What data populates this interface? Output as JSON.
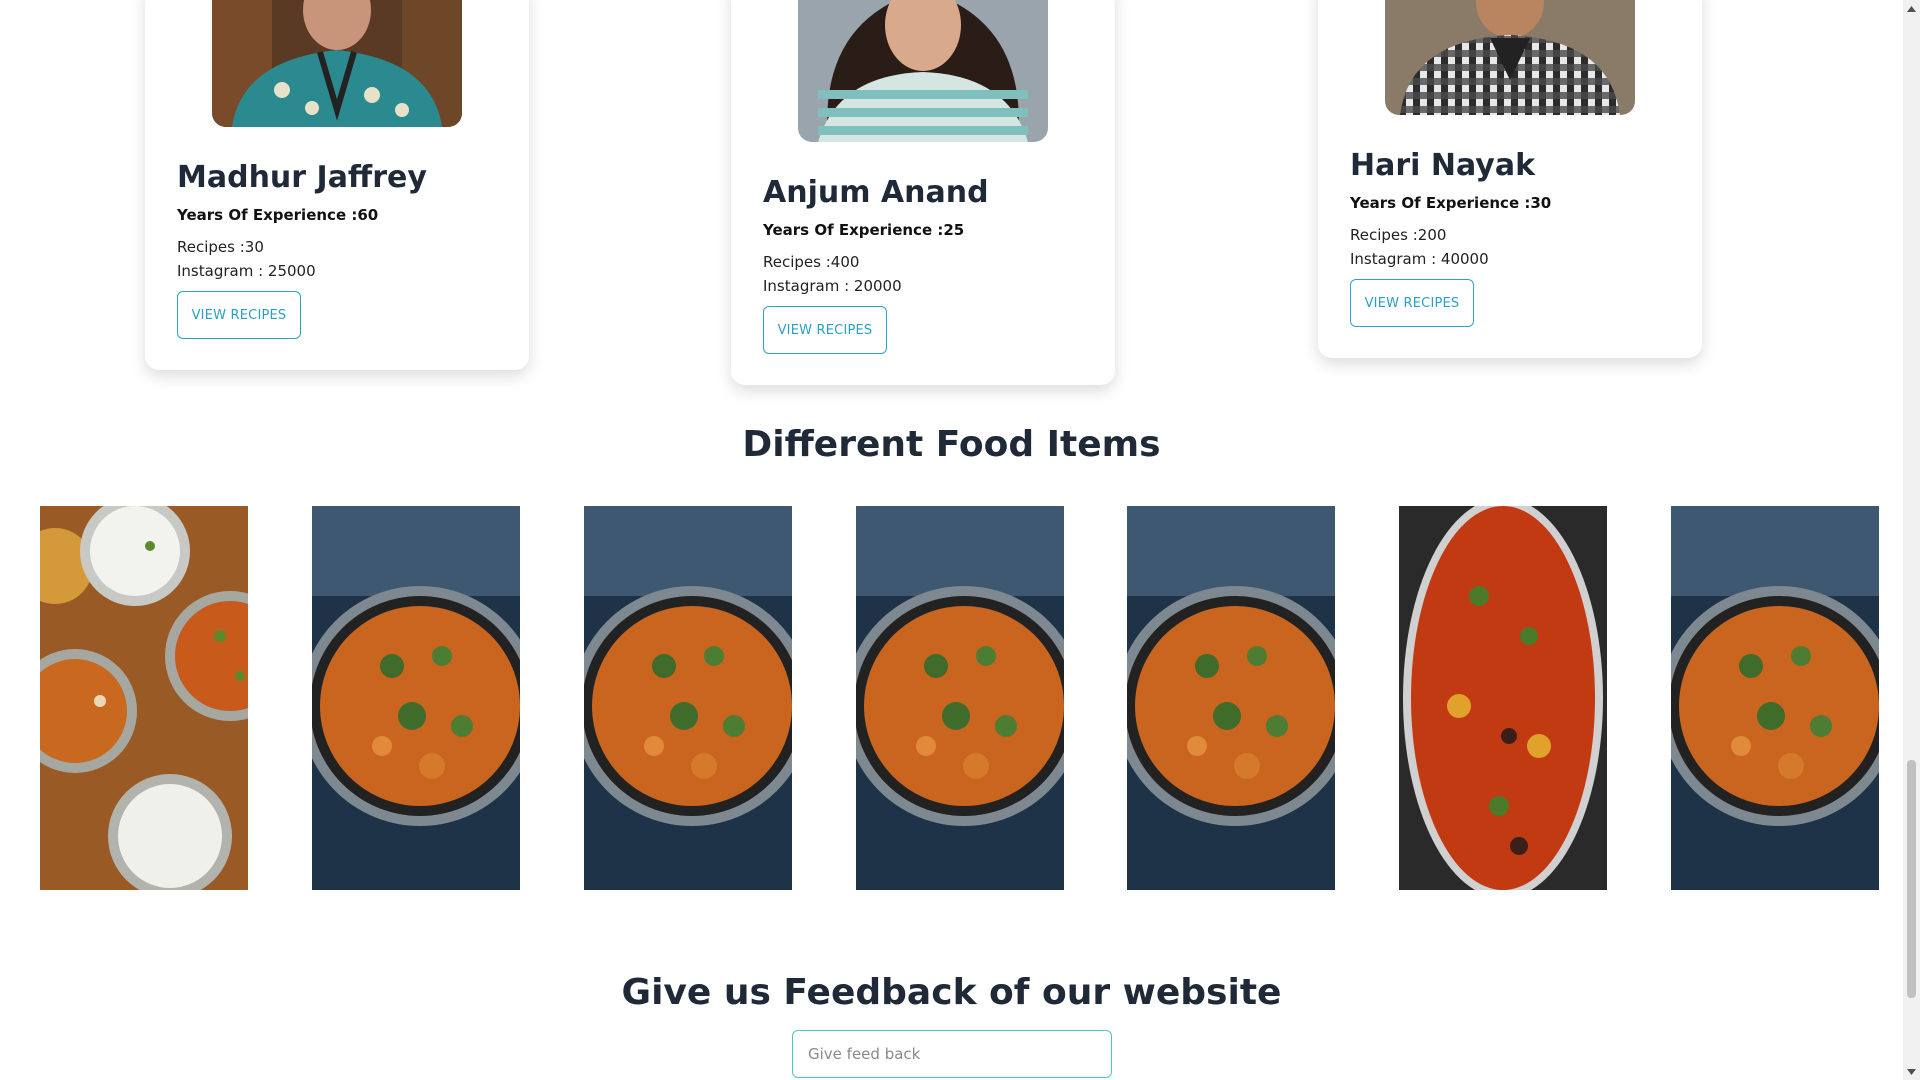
{
  "chefs": [
    {
      "name": "Madhur Jaffrey",
      "experience": "Years Of Experience :60",
      "recipes": "Recipes :30",
      "instagram": "Instagram : 25000",
      "button": "VIEW RECIPES"
    },
    {
      "name": "Anjum Anand",
      "experience": "Years Of Experience :25",
      "recipes": "Recipes :400",
      "instagram": "Instagram : 20000",
      "button": "VIEW RECIPES"
    },
    {
      "name": "Hari Nayak",
      "experience": "Years Of Experience :30",
      "recipes": "Recipes :200",
      "instagram": "Instagram : 40000",
      "button": "VIEW RECIPES"
    }
  ],
  "food_section": {
    "title": "Different Food Items",
    "items": [
      "curry-bowls-photo",
      "curry-pan-photo",
      "curry-pan-photo",
      "curry-pan-photo",
      "curry-pan-photo",
      "stock-curry-photo",
      "curry-pan-photo"
    ]
  },
  "feedback": {
    "title": "Give us Feedback of our website",
    "placeholder": "Give feed back"
  },
  "colors": {
    "accent": "#2aa4c9",
    "input_border": "#4cc6c6",
    "heading": "#1f2937"
  }
}
